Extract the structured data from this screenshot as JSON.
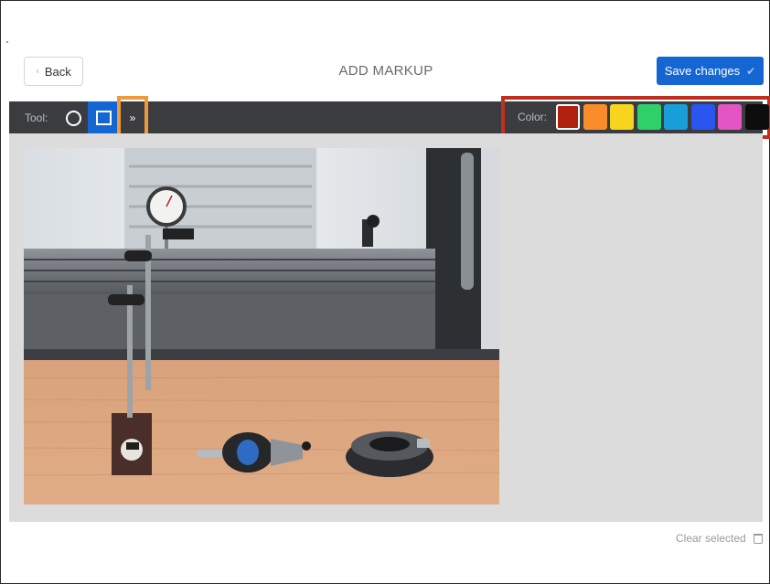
{
  "header": {
    "back_label": "Back",
    "back_icon": "chevron-left-icon",
    "title": "ADD MARKUP",
    "save_label": "Save changes",
    "save_icon": "checkmark-icon"
  },
  "toolbar": {
    "tool_label": "Tool:",
    "tools": [
      {
        "name": "circle-tool",
        "icon": "circle-outline-icon",
        "selected": false
      },
      {
        "name": "rectangle-tool",
        "icon": "square-outline-icon",
        "selected": true
      }
    ],
    "expand_label": "»",
    "expand_icon": "double-chevron-right-icon",
    "color_label": "Color:",
    "colors": [
      "#b0220f",
      "#fb8c2b",
      "#f5d51d",
      "#2fd06a",
      "#1a9ed9",
      "#2a55ef",
      "#e255c3",
      "#0d0d0d"
    ],
    "selected_color_index": 0,
    "accent": "#1466d2",
    "highlight_tool": "#ee9a3a",
    "highlight_color": "#c0301f"
  },
  "footer": {
    "clear_label": "Clear selected",
    "clear_icon": "trash-icon"
  }
}
